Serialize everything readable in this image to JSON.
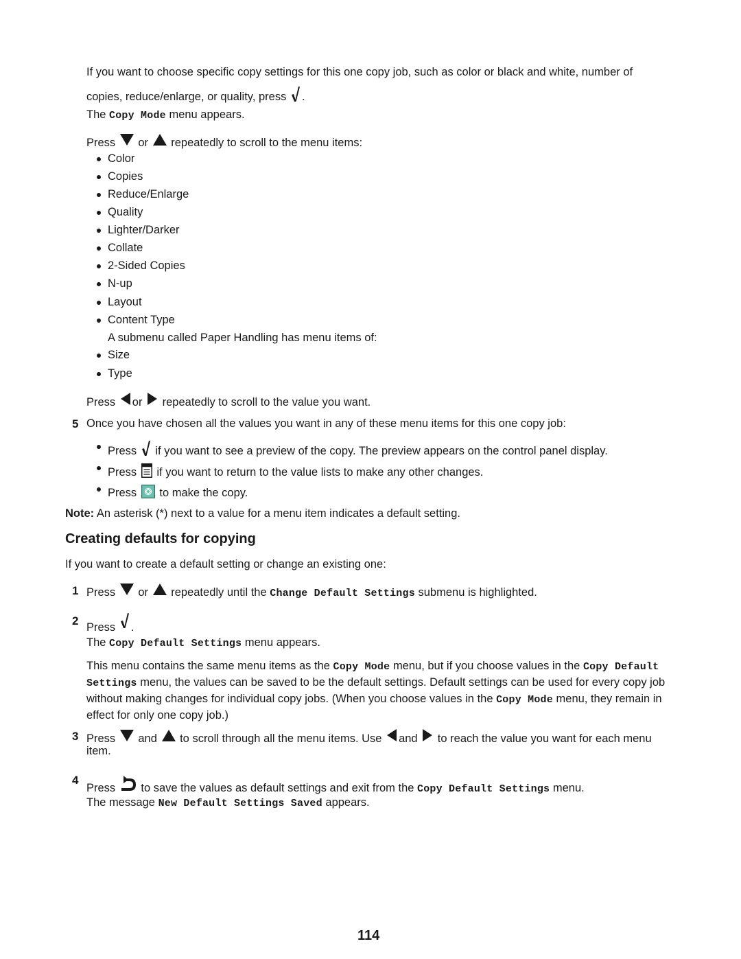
{
  "page": {
    "intro": {
      "line1": "If you want to choose specific copy settings for this one copy job, such as color or black and white, number of",
      "line2_pre": "copies, reduce/enlarge, or quality, press",
      "line2_post": ".",
      "menu_appears_pre": "The",
      "menu_appears_code": "Copy Mode",
      "menu_appears_post": "menu appears.",
      "scroll_pre": "Press",
      "scroll_or": "or",
      "scroll_post": "repeatedly to scroll to the menu items:"
    },
    "menu_items": [
      "Color",
      "Copies",
      "Reduce/Enlarge",
      "Quality",
      "Lighter/Darker",
      "Collate",
      "2-Sided Copies",
      "N-up",
      "Layout",
      "Content Type"
    ],
    "submenu_note": "A submenu called Paper Handling has menu items of:",
    "submenu_items": [
      "Size",
      "Type"
    ],
    "value_scroll": {
      "pre": "Press",
      "or": "or",
      "post": "repeatedly to scroll to the value you want."
    },
    "step5": {
      "num": "5",
      "text": "Once you have chosen all the values you want in any of these menu items for this one copy job:",
      "bullets": [
        {
          "pre": "Press",
          "icon": "check-icon",
          "post": "if you want to see a preview of the copy. The preview appears on the control panel display."
        },
        {
          "pre": "Press",
          "icon": "menu-icon",
          "post": "if you want to return to the value lists to make any other changes."
        },
        {
          "pre": "Press",
          "icon": "start-icon",
          "post": "to make the copy."
        }
      ]
    },
    "note": {
      "label": "Note:",
      "text": "An asterisk (*) next to a value for a menu item indicates a default setting."
    },
    "section": {
      "title": "Creating defaults for copying",
      "intro": "If you want to create a default setting or change an existing one:"
    },
    "steps": {
      "s1": {
        "num": "1",
        "pre": "Press",
        "or": "or",
        "mid": "repeatedly until the",
        "code": "Change Default Settings",
        "post": "submenu is highlighted."
      },
      "s2": {
        "num": "2",
        "pre": "Press",
        "post": ".",
        "appears_pre": "The",
        "appears_code": "Copy Default Settings",
        "appears_post": "menu appears.",
        "para": {
          "t1": "This menu contains the same menu items as the",
          "c1": "Copy Mode",
          "t2": "menu, but if you choose values in the",
          "c2": "Copy Default Settings",
          "t3": "menu, the values can be saved to be the default settings. Default settings can be used for every copy job without making changes for individual copy jobs. (When you choose values in the",
          "c3": "Copy Mode",
          "t4": "menu, they remain in effect for only one copy job.)"
        }
      },
      "s3": {
        "num": "3",
        "pre": "Press",
        "and1": "and",
        "mid": "to scroll through all the menu items. Use",
        "and2": "and",
        "post": "to reach the value you want for each menu",
        "post2": "item."
      },
      "s4": {
        "num": "4",
        "pre": "Press",
        "mid": "to save the values as default settings and exit from the",
        "code": "Copy Default Settings",
        "post": "menu.",
        "msg_pre": "The message",
        "msg_code": "New Default Settings Saved",
        "msg_post": "appears."
      }
    },
    "page_number": "114",
    "colors": {
      "start_button": "#5fb3a3",
      "text": "#1a1a1a"
    }
  }
}
